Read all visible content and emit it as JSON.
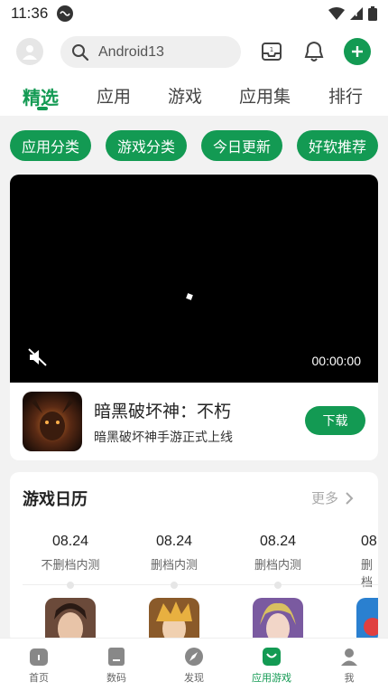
{
  "status_bar": {
    "time": "11:36"
  },
  "header": {
    "search_value": "Android13"
  },
  "tabs": [
    "精选",
    "应用",
    "游戏",
    "应用集",
    "排行"
  ],
  "chips": [
    "应用分类",
    "游戏分类",
    "今日更新",
    "好软推荐"
  ],
  "featured": {
    "video_time": "00:00:00",
    "app_title": "暗黑破坏神：不朽",
    "app_subtitle": "暗黑破坏神手游正式上线",
    "download_label": "下载"
  },
  "calendar": {
    "title": "游戏日历",
    "more_label": "更多",
    "items": [
      {
        "date": "08.24",
        "label": "不删档内测"
      },
      {
        "date": "08.24",
        "label": "删档内测"
      },
      {
        "date": "08.24",
        "label": "删档内测"
      },
      {
        "date": "08",
        "label": "删档"
      }
    ]
  },
  "bottom_nav": [
    "首页",
    "数码",
    "发现",
    "应用游戏",
    "我"
  ],
  "colors": {
    "accent": "#139a53",
    "background": "#f2f2f2"
  }
}
